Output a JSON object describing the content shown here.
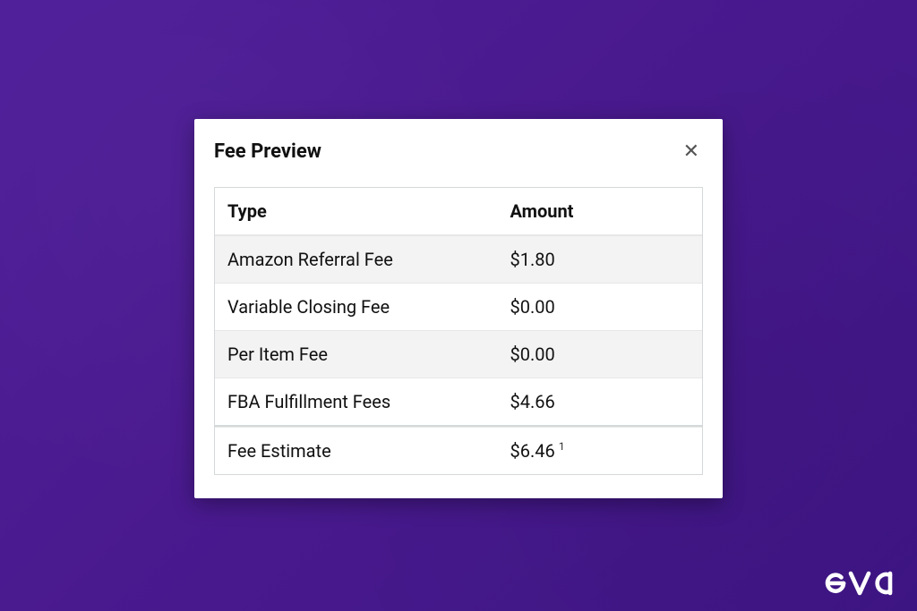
{
  "modal": {
    "title": "Fee Preview",
    "close_glyph": "✕",
    "columns": {
      "type": "Type",
      "amount": "Amount"
    },
    "rows": [
      {
        "label": "Amazon Referral Fee",
        "amount": "$1.80",
        "alt": true
      },
      {
        "label": "Variable Closing Fee",
        "amount": "$0.00",
        "alt": false
      },
      {
        "label": "Per Item Fee",
        "amount": "$0.00",
        "alt": true
      }
    ],
    "subtotal": {
      "label": "FBA Fulfillment Fees",
      "amount": "$4.66"
    },
    "estimate": {
      "label": "Fee Estimate",
      "amount": "$6.46",
      "footnote": "1"
    }
  },
  "brand": {
    "name": "eva"
  }
}
